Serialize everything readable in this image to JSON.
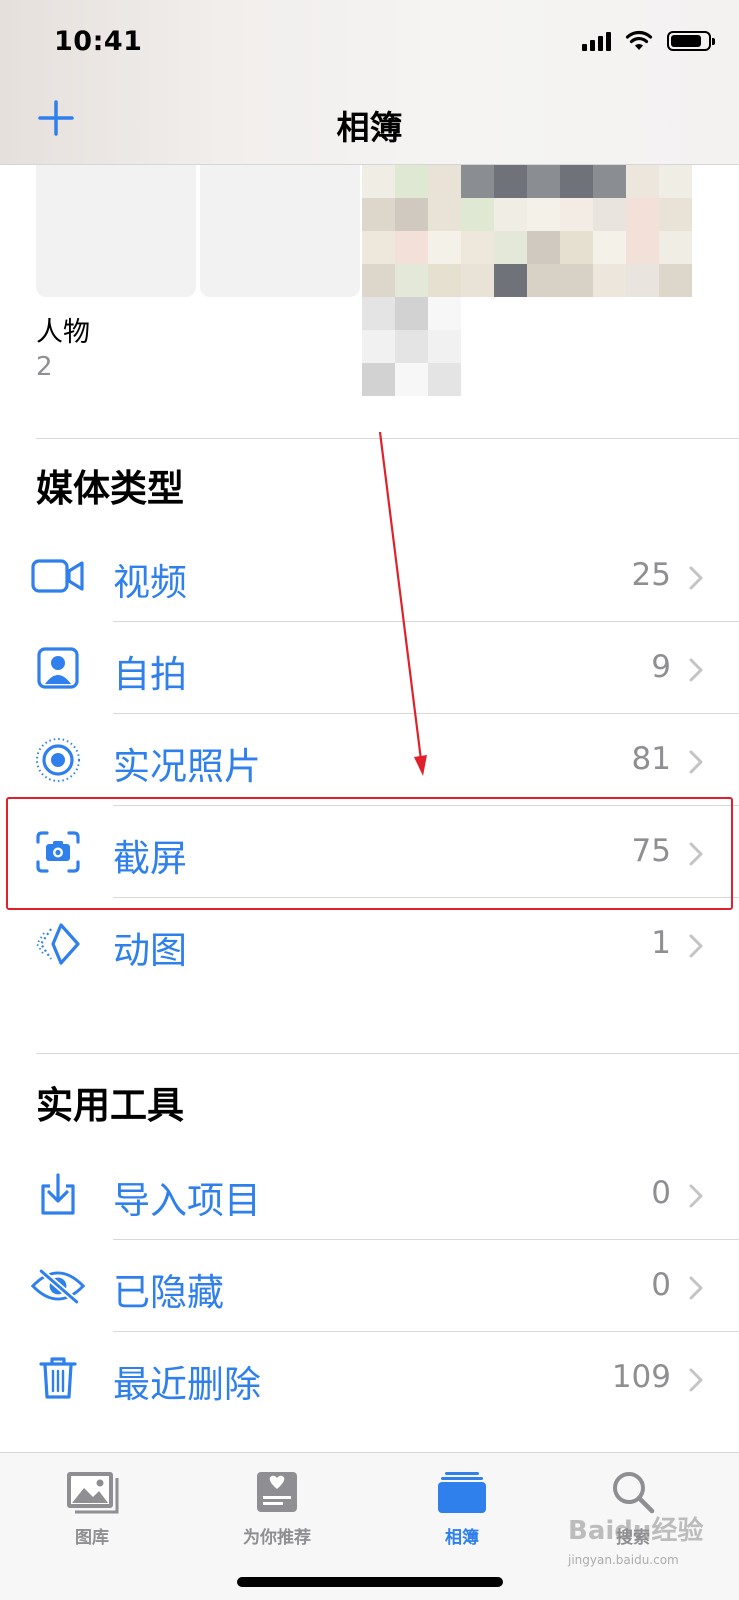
{
  "status": {
    "time": "10:41"
  },
  "nav": {
    "title": "相簿",
    "add_icon": "plus-icon"
  },
  "people": {
    "label": "人物",
    "count": "2"
  },
  "media_section": {
    "title": "媒体类型",
    "items": [
      {
        "icon": "video-icon",
        "label": "视频",
        "count": "25"
      },
      {
        "icon": "selfie-icon",
        "label": "自拍",
        "count": "9"
      },
      {
        "icon": "live-photo-icon",
        "label": "实况照片",
        "count": "81"
      },
      {
        "icon": "screenshot-icon",
        "label": "截屏",
        "count": "75"
      },
      {
        "icon": "animated-icon",
        "label": "动图",
        "count": "1"
      }
    ]
  },
  "utilities_section": {
    "title": "实用工具",
    "items": [
      {
        "icon": "import-icon",
        "label": "导入项目",
        "count": "0"
      },
      {
        "icon": "hidden-eye-icon",
        "label": "已隐藏",
        "count": "0"
      },
      {
        "icon": "trash-icon",
        "label": "最近删除",
        "count": "109"
      }
    ]
  },
  "tabbar": {
    "tabs": [
      {
        "icon": "photos-library-icon",
        "label": "图库"
      },
      {
        "icon": "for-you-icon",
        "label": "为你推荐"
      },
      {
        "icon": "albums-icon",
        "label": "相簿",
        "active": true
      },
      {
        "icon": "search-icon",
        "label": "搜索"
      }
    ]
  },
  "watermark": {
    "text": "Baidu经验",
    "sub": "jingyan.baidu.com"
  },
  "colors": {
    "accent": "#2f80ed",
    "highlight": "#e0202a",
    "secondary_text": "#8e8e93"
  }
}
